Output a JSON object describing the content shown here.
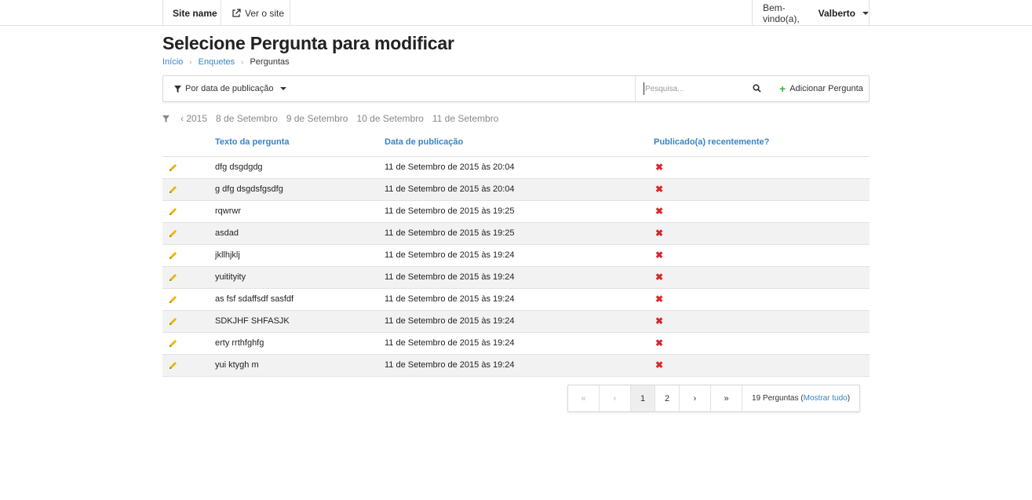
{
  "header": {
    "site_name": "Site name",
    "view_site": "Ver o site",
    "welcome": "Bem-vindo(a),",
    "username": "Valberto"
  },
  "page": {
    "title": "Selecione Pergunta para modificar"
  },
  "breadcrumb": {
    "items": [
      "Início",
      "Enquetes"
    ],
    "current": "Perguntas"
  },
  "toolbar": {
    "date_filter_label": "Por data de publicação",
    "search_placeholder": "Pesquisa...",
    "add_label": "Adicionar Pergunta"
  },
  "date_hierarchy": {
    "back": "‹ 2015",
    "items": [
      "8 de Setembro",
      "9 de Setembro",
      "10 de Setembro",
      "11 de Setembro"
    ]
  },
  "table": {
    "columns": [
      "Texto da pergunta",
      "Data de publicação",
      "Publicado(a) recentemente?"
    ],
    "rows": [
      {
        "text": "dfg dsgdgdg",
        "date": "11 de Setembro de 2015 às 20:04",
        "recent": "✖"
      },
      {
        "text": "g dfg dsgdsfgsdfg",
        "date": "11 de Setembro de 2015 às 20:04",
        "recent": "✖"
      },
      {
        "text": "rqwrwr",
        "date": "11 de Setembro de 2015 às 19:25",
        "recent": "✖"
      },
      {
        "text": "asdad",
        "date": "11 de Setembro de 2015 às 19:25",
        "recent": "✖"
      },
      {
        "text": "jkllhjklj",
        "date": "11 de Setembro de 2015 às 19:24",
        "recent": "✖"
      },
      {
        "text": "yuitityity",
        "date": "11 de Setembro de 2015 às 19:24",
        "recent": "✖"
      },
      {
        "text": "as fsf sdaffsdf sasfdf",
        "date": "11 de Setembro de 2015 às 19:24",
        "recent": "✖"
      },
      {
        "text": "SDKJHF SHFASJK",
        "date": "11 de Setembro de 2015 às 19:24",
        "recent": "✖"
      },
      {
        "text": "erty rrthfghfg",
        "date": "11 de Setembro de 2015 às 19:24",
        "recent": "✖"
      },
      {
        "text": "yui ktygh m",
        "date": "11 de Setembro de 2015 às 19:24",
        "recent": "✖"
      }
    ]
  },
  "pagination": {
    "first": "«",
    "prev": "‹",
    "pages": [
      "1",
      "2"
    ],
    "next": "›",
    "last": "»",
    "count_text": "19 Perguntas (",
    "show_all": "Mostrar tudo",
    "count_close": ")"
  },
  "colors": {
    "link": "#3a84c4",
    "edit_icon": "#f0b400",
    "no_icon": "#d9262c",
    "add_icon": "#3cb043"
  },
  "icons": {
    "external_link": "external-link-icon",
    "filter": "filter-icon",
    "search": "search-icon",
    "plus": "plus-icon",
    "edit": "pencil-icon",
    "boolean_no": "red-x-icon"
  }
}
